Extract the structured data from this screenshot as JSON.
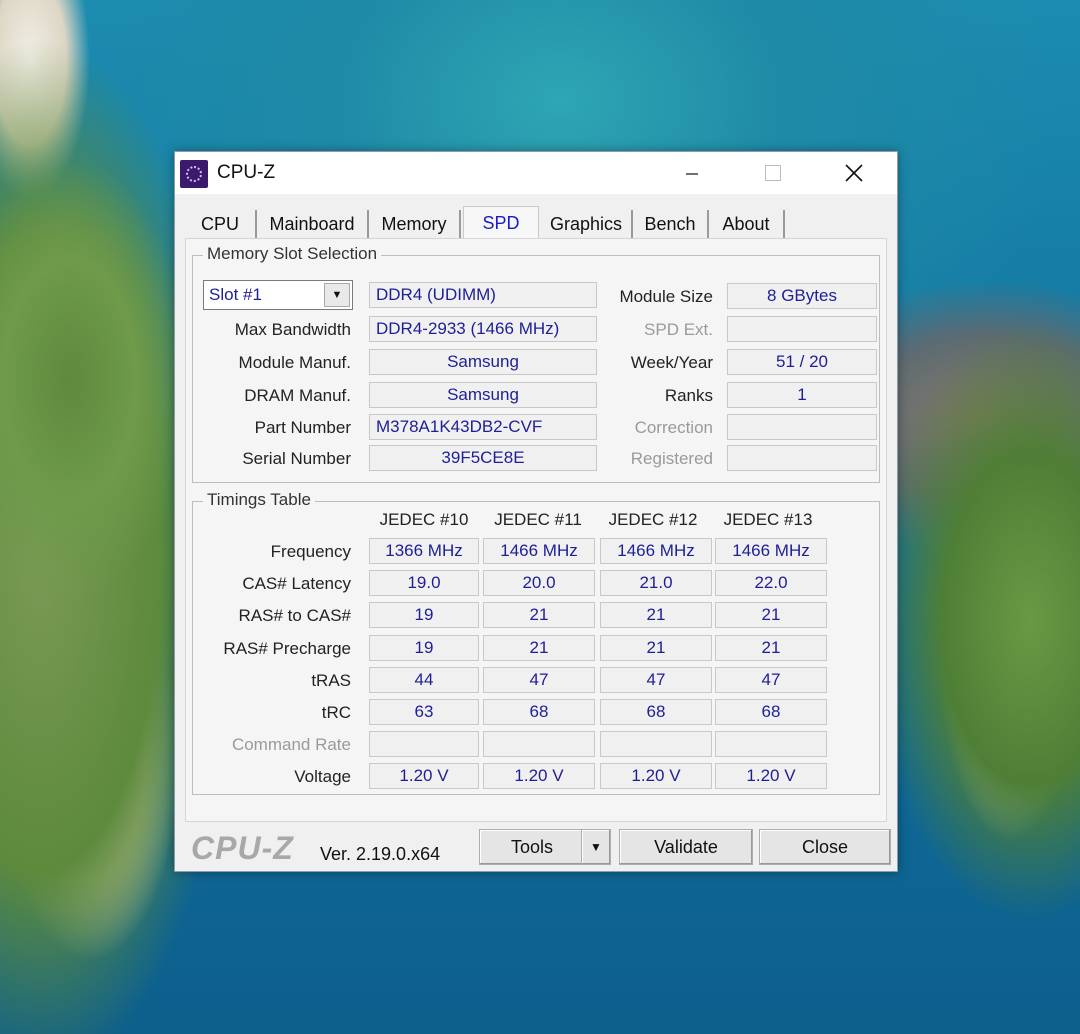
{
  "window": {
    "title": "CPU-Z"
  },
  "tabs": [
    {
      "label": "CPU"
    },
    {
      "label": "Mainboard"
    },
    {
      "label": "Memory"
    },
    {
      "label": "SPD"
    },
    {
      "label": "Graphics"
    },
    {
      "label": "Bench"
    },
    {
      "label": "About"
    }
  ],
  "active_tab": "SPD",
  "slot": {
    "group_title": "Memory Slot Selection",
    "selected": "Slot #1",
    "type": "DDR4 (UDIMM)",
    "max_bandwidth_label": "Max Bandwidth",
    "max_bandwidth": "DDR4-2933 (1466 MHz)",
    "module_manuf_label": "Module Manuf.",
    "module_manuf": "Samsung",
    "dram_manuf_label": "DRAM Manuf.",
    "dram_manuf": "Samsung",
    "part_number_label": "Part Number",
    "part_number": "M378A1K43DB2-CVF",
    "serial_number_label": "Serial Number",
    "serial_number": "39F5CE8E",
    "module_size_label": "Module Size",
    "module_size": "8 GBytes",
    "spd_ext_label": "SPD Ext.",
    "spd_ext": "",
    "week_year_label": "Week/Year",
    "week_year": "51 / 20",
    "ranks_label": "Ranks",
    "ranks": "1",
    "correction_label": "Correction",
    "correction": "",
    "registered_label": "Registered",
    "registered": ""
  },
  "timings": {
    "group_title": "Timings Table",
    "columns": [
      "JEDEC #10",
      "JEDEC #11",
      "JEDEC #12",
      "JEDEC #13"
    ],
    "rows": [
      {
        "label": "Frequency",
        "values": [
          "1366 MHz",
          "1466 MHz",
          "1466 MHz",
          "1466 MHz"
        ]
      },
      {
        "label": "CAS# Latency",
        "values": [
          "19.0",
          "20.0",
          "21.0",
          "22.0"
        ]
      },
      {
        "label": "RAS# to CAS#",
        "values": [
          "19",
          "21",
          "21",
          "21"
        ]
      },
      {
        "label": "RAS# Precharge",
        "values": [
          "19",
          "21",
          "21",
          "21"
        ]
      },
      {
        "label": "tRAS",
        "values": [
          "44",
          "47",
          "47",
          "47"
        ]
      },
      {
        "label": "tRC",
        "values": [
          "63",
          "68",
          "68",
          "68"
        ]
      },
      {
        "label": "Command Rate",
        "values": [
          "",
          "",
          "",
          ""
        ]
      },
      {
        "label": "Voltage",
        "values": [
          "1.20 V",
          "1.20 V",
          "1.20 V",
          "1.20 V"
        ]
      }
    ]
  },
  "footer": {
    "logo": "CPU-Z",
    "version": "Ver. 2.19.0.x64",
    "tools_label": "Tools",
    "validate_label": "Validate",
    "close_label": "Close"
  }
}
